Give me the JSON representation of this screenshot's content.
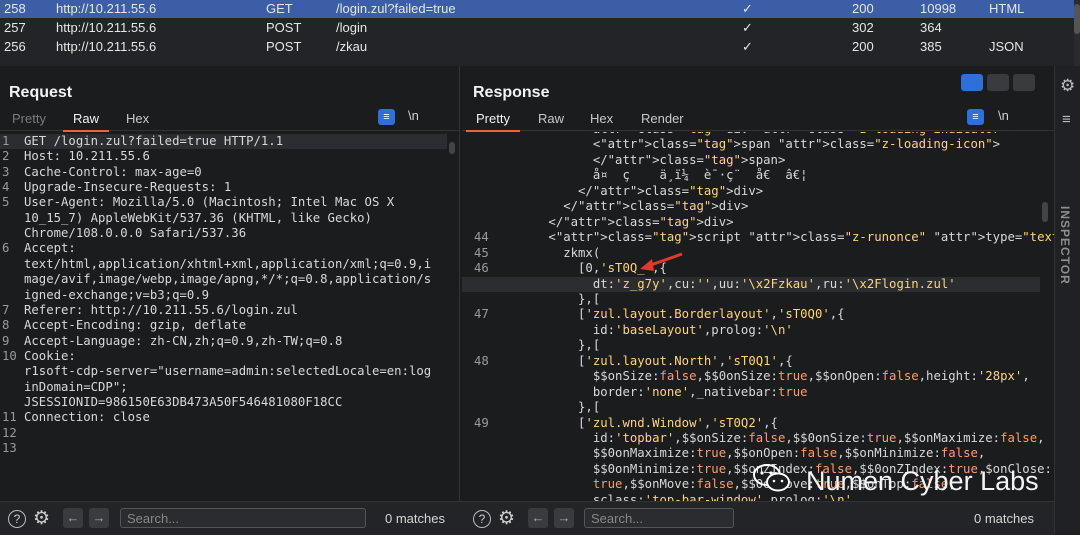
{
  "history": {
    "rows": [
      {
        "num": "258",
        "host": "http://10.211.55.6",
        "method": "GET",
        "url": "/login.zul?failed=true",
        "check": "✓",
        "status": "200",
        "length": "10998",
        "mime": "HTML"
      },
      {
        "num": "257",
        "host": "http://10.211.55.6",
        "method": "POST",
        "url": "/login",
        "check": "✓",
        "status": "302",
        "length": "364",
        "mime": ""
      },
      {
        "num": "256",
        "host": "http://10.211.55.6",
        "method": "POST",
        "url": "/zkau",
        "check": "✓",
        "status": "200",
        "length": "385",
        "mime": "JSON"
      }
    ]
  },
  "request": {
    "title": "Request",
    "tabs": [
      "Pretty",
      "Raw",
      "Hex"
    ],
    "newline_toggle": "\\n",
    "lines": [
      {
        "n": "1",
        "t": "GET /login.zul?failed=true HTTP/1.1"
      },
      {
        "n": "2",
        "t": "Host: 10.211.55.6"
      },
      {
        "n": "3",
        "t": "Cache-Control: max-age=0"
      },
      {
        "n": "4",
        "t": "Upgrade-Insecure-Requests: 1"
      },
      {
        "n": "5",
        "t": "User-Agent: Mozilla/5.0 (Macintosh; Intel Mac OS X"
      },
      {
        "n": "",
        "t": "10_15_7) AppleWebKit/537.36 (KHTML, like Gecko)"
      },
      {
        "n": "",
        "t": "Chrome/108.0.0.0 Safari/537.36"
      },
      {
        "n": "6",
        "t": "Accept:"
      },
      {
        "n": "",
        "t": "text/html,application/xhtml+xml,application/xml;q=0.9,i"
      },
      {
        "n": "",
        "t": "mage/avif,image/webp,image/apng,*/*;q=0.8,application/s"
      },
      {
        "n": "",
        "t": "igned-exchange;v=b3;q=0.9"
      },
      {
        "n": "7",
        "t": "Referer: http://10.211.55.6/login.zul"
      },
      {
        "n": "8",
        "t": "Accept-Encoding: gzip, deflate"
      },
      {
        "n": "9",
        "t": "Accept-Language: zh-CN,zh;q=0.9,zh-TW;q=0.8"
      },
      {
        "n": "10",
        "t": "Cookie:"
      },
      {
        "n": "",
        "t": "r1soft-cdp-server=\"username=admin:selectedLocale=en:log"
      },
      {
        "n": "",
        "t": "inDomain=CDP\";"
      },
      {
        "n": "",
        "t": "JSESSIONID=986150E63DB473A50F546481080F18CC"
      },
      {
        "n": "11",
        "t": "Connection: close"
      },
      {
        "n": "12",
        "t": ""
      },
      {
        "n": "13",
        "t": ""
      }
    ],
    "search_placeholder": "Search...",
    "matches": "0 matches"
  },
  "response": {
    "title": "Response",
    "tabs": [
      "Pretty",
      "Raw",
      "Hex",
      "Render"
    ],
    "newline_toggle": "\\n",
    "lines": [
      {
        "n": "",
        "t": "          <div class=\"z-loading-indicator\">"
      },
      {
        "n": "",
        "t": "            <span class=\"z-loading-icon\">"
      },
      {
        "n": "",
        "t": "            </span>"
      },
      {
        "n": "",
        "t": "            å¤  ç    ä¸­ï¼  è¯·ç¨  å€  â€¦"
      },
      {
        "n": "",
        "t": "          </div>"
      },
      {
        "n": "",
        "t": "        </div>"
      },
      {
        "n": "",
        "t": "      </div>"
      },
      {
        "n": "44",
        "t": "      <script class=\"z-runonce\" type=\"text/javascript\">"
      },
      {
        "n": "45",
        "t": "        zkmx("
      },
      {
        "n": "46",
        "t": "          [0,'sT0Q_',{"
      },
      {
        "n": "",
        "t": "            dt:'z_g7y',cu:'',uu:'\\x2Fzkau',ru:'\\x2Flogin.zul'"
      },
      {
        "n": "",
        "t": "          },["
      },
      {
        "n": "47",
        "t": "          ['zul.layout.Borderlayout','sT0Q0',{"
      },
      {
        "n": "",
        "t": "            id:'baseLayout',prolog:'\\n'"
      },
      {
        "n": "",
        "t": "          },["
      },
      {
        "n": "48",
        "t": "          ['zul.layout.North','sT0Q1',{"
      },
      {
        "n": "",
        "t": "            $$onSize:false,$$0onSize:true,$$onOpen:false,height:'28px',"
      },
      {
        "n": "",
        "t": "            border:'none',_nativebar:true"
      },
      {
        "n": "",
        "t": "          },["
      },
      {
        "n": "49",
        "t": "          ['zul.wnd.Window','sT0Q2',{"
      },
      {
        "n": "",
        "t": "            id:'topbar',$$onSize:false,$$0onSize:true,$$onMaximize:false,"
      },
      {
        "n": "",
        "t": "            $$0onMaximize:true,$$onOpen:false,$$onMinimize:false,"
      },
      {
        "n": "",
        "t": "            $$0onMinimize:true,$$onZIndex:false,$$0onZIndex:true,$onClose:"
      },
      {
        "n": "",
        "t": "            true,$$onMove:false,$$0onMove:true,$$onTop:false,"
      },
      {
        "n": "",
        "t": "            sclass:'top-bar-window',prolog:'\\n'"
      }
    ],
    "search_placeholder": "Search...",
    "matches": "0 matches"
  },
  "inspector": {
    "label": "INSPECTOR"
  },
  "watermark": {
    "text": "Numen Cyber Labs"
  },
  "colors": {
    "accent_tab": "#e8643a",
    "selected_row": "#3b5ea7",
    "arrow": "#e03a2a"
  }
}
